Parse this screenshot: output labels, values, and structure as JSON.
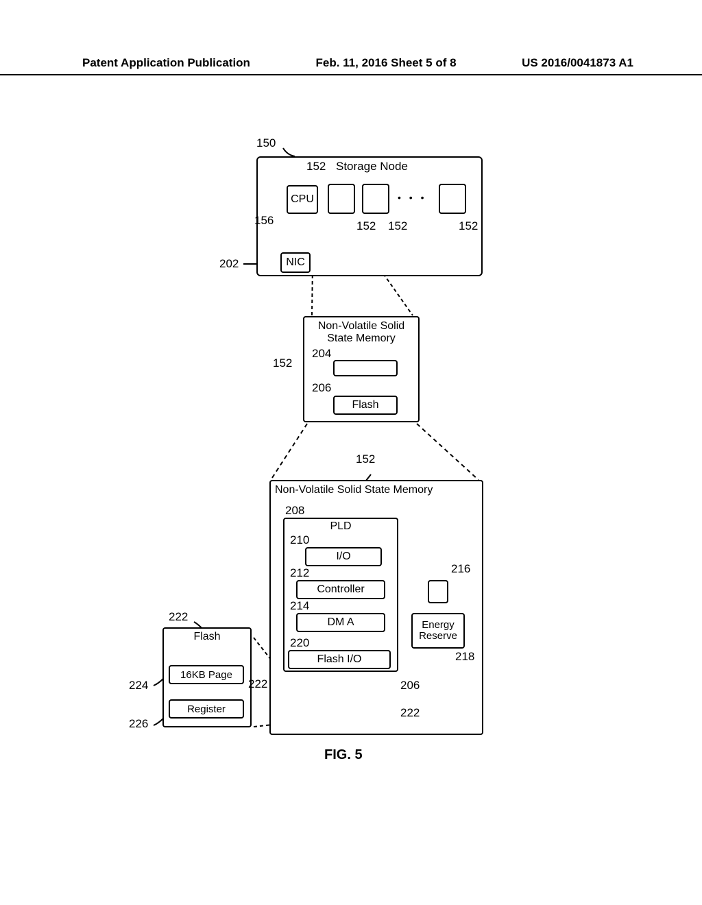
{
  "header": {
    "left": "Patent Application Publication",
    "center": "Feb. 11, 2016  Sheet 5 of 8",
    "right": "US 2016/0041873 A1"
  },
  "topbox": {
    "ref150": "150",
    "ref152_title_num": "152",
    "ref152_title_text": "Storage Node",
    "cpu": "CPU",
    "ref156": "156",
    "ref152a": "152",
    "ref152b": "152",
    "ref152c": "152",
    "dots": "• • •",
    "nic": "NIC",
    "ref202": "202"
  },
  "midbox": {
    "title": "Non-Volatile Solid State Memory",
    "ref204": "204",
    "ref152": "152",
    "ref206": "206",
    "flash": "Flash"
  },
  "bigbox": {
    "ref152": "152",
    "title": "Non-Volatile Solid State Memory",
    "pld": "PLD",
    "ref208": "208",
    "io": "I/O",
    "ref210": "210",
    "controller": "Controller",
    "ref212": "212",
    "dma": "DM A",
    "ref214": "214",
    "flashio": "Flash I/O",
    "ref220": "220",
    "ref216": "216",
    "energy": "Energy Reserve",
    "ref218": "218",
    "ref206": "206",
    "ref222": "222"
  },
  "leftdetail": {
    "ref222": "222",
    "flash": "Flash",
    "page": "16KB Page",
    "ref224": "224",
    "register": "Register",
    "ref226": "226",
    "ref222b": "222"
  },
  "figcap": "FIG. 5"
}
